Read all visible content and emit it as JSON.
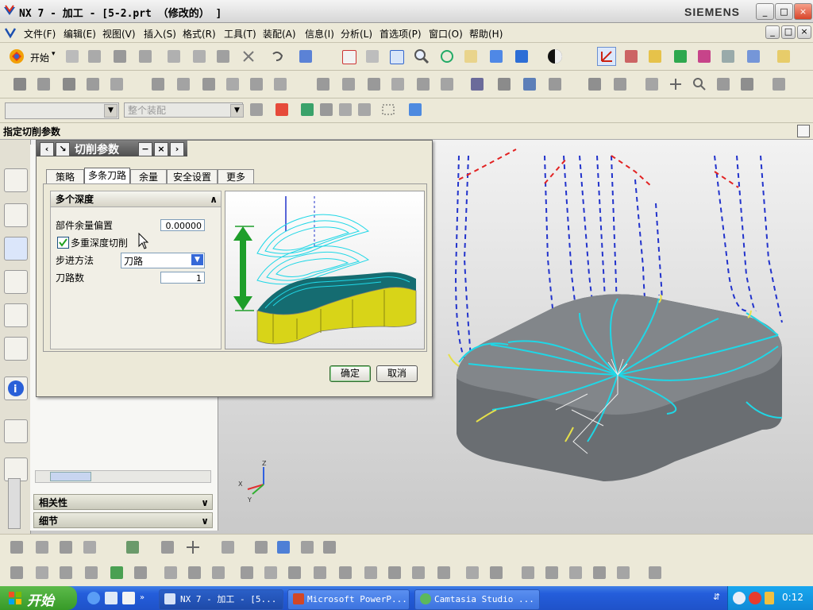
{
  "window": {
    "title": "NX 7 - 加工 - [5-2.prt （修改的） ]",
    "brand": "SIEMENS",
    "min": "_",
    "max": "□",
    "close": "×"
  },
  "menu": [
    "文件(F)",
    "编辑(E)",
    "视图(V)",
    "插入(S)",
    "格式(R)",
    "工具(T)",
    "装配(A)",
    "信息(I)",
    "分析(L)",
    "首选项(P)",
    "窗口(O)",
    "帮助(H)"
  ],
  "toolbar": {
    "start_label": "开始",
    "filter_placeholder": "整个装配"
  },
  "cue_line": "指定切削参数",
  "dialog": {
    "title": "切削参数",
    "tabs": [
      "策略",
      "多条刀路",
      "余量",
      "安全设置",
      "更多"
    ],
    "active_tab": 1,
    "group_title": "多个深度",
    "fields": {
      "part_offset_label": "部件余量偏置",
      "part_offset_value": "0.00000",
      "multi_depth_label": "多重深度切削",
      "multi_depth_checked": true,
      "step_method_label": "步进方法",
      "step_method_value": "刀路",
      "passes_label": "刀路数",
      "passes_value": "1"
    },
    "ok": "确定",
    "cancel": "取消"
  },
  "nav_panel": {
    "relevance": "相关性",
    "details": "细节"
  },
  "taskbar": {
    "start": "开始",
    "tasks": [
      "NX 7 - 加工 - [5...",
      "Microsoft PowerP...",
      "Camtasia Studio ..."
    ],
    "time": "0:12"
  },
  "colors": {
    "toolpath": "#1fd7e6",
    "depth_arrow": "#1e9e2a",
    "part_body": "#6a6e72",
    "rapid": "#2233cc",
    "engage": "#e22222"
  }
}
